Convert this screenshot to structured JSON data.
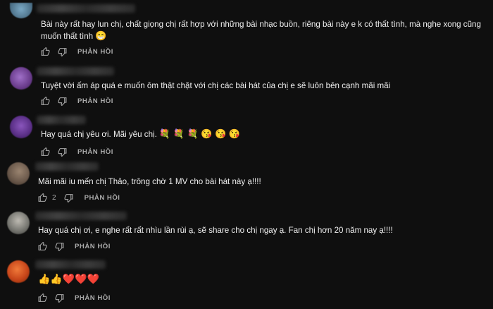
{
  "comments": [
    {
      "text_lines": [
        "Bài này rất hay lun chị, chất giọng chị rất hợp với những bài nhạc buồn, riêng bài này e k có thất tình, mà nghe xong cũng",
        "muốn thất tình"
      ],
      "emoji": "😁",
      "like_count": "",
      "reply_label": "PHẢN HỒI",
      "avatar_color": "#3a5a70"
    },
    {
      "text_lines": [
        "Tuyệt vời ấm áp quá e muốn ôm thật chặt với chị các bài hát của chị e sẽ luôn bên cạnh mãi mãi"
      ],
      "emoji": "",
      "like_count": "",
      "reply_label": "PHẢN HỒI",
      "avatar_color": "#6a3c8c"
    },
    {
      "text_lines": [
        "Hay quá chị yêu ơi. Mãi yêu chị."
      ],
      "emoji": "💐 💐 💐 😘 😘 😘",
      "like_count": "",
      "reply_label": "PHẢN HỒI",
      "avatar_color": "#5a2f86"
    },
    {
      "text_lines": [
        "Mãi mãi iu mến chị Thảo, trông chờ 1 MV cho bài hát này ạ!!!!"
      ],
      "emoji": "",
      "like_count": "2",
      "reply_label": "PHẢN HỒI",
      "avatar_color": "#6c5a4c"
    },
    {
      "text_lines": [
        "Hay quá chị ơi, e nghe rất rất nhìu lần rùi ạ, sẽ share cho chị ngay ạ. Fan chị hơn 20 năm nay ạ!!!!"
      ],
      "emoji": "",
      "like_count": "",
      "reply_label": "PHẢN HỒI",
      "avatar_color": "#7a7a74"
    },
    {
      "text_lines": [
        ""
      ],
      "emoji": "👍👍❤️❤️❤️",
      "like_count": "",
      "reply_label": "PHẢN HỒI",
      "avatar_color": "#c8461a"
    }
  ],
  "icons": {
    "like": "thumbs-up-icon",
    "dislike": "thumbs-down-icon"
  }
}
